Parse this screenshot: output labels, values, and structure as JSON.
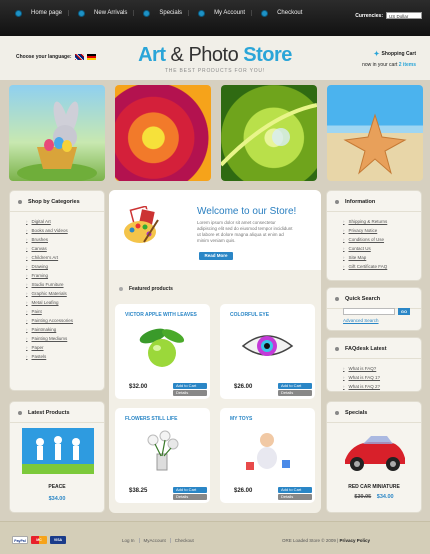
{
  "nav": {
    "items": [
      "Home page",
      "New Arrivals",
      "Specials",
      "My Account",
      "Checkout"
    ],
    "currency_label": "Currencies:",
    "currency_value": "US Dollar"
  },
  "header": {
    "language_label": "Choose your language:",
    "logo_part1": "Art",
    "logo_part2": "& Photo",
    "logo_part3": "Store",
    "tagline": "THE BEST PRODUCTS FOR YOU!",
    "cart_title": "Shopping Cart",
    "cart_line_prefix": "now in your cart",
    "cart_items": "2 items"
  },
  "categories": {
    "title": "Shop by Categories",
    "items": [
      "Digital Art",
      "Books and Videos",
      "Brushes",
      "Canvas",
      "Children's Art",
      "Drawing",
      "Framing",
      "Studio Furniture",
      "Graphic Materials",
      "Metal Leafing",
      "Paint",
      "Painting Accessories",
      "Paintmaking",
      "Painting Mediums",
      "Paper",
      "Pastels"
    ]
  },
  "latest": {
    "title": "Latest Products",
    "name": "PEACE",
    "price": "$34.00"
  },
  "welcome": {
    "title": "Welcome to our Store!",
    "text": "Lorem ipsum dolor sit amet consectetur adipiscing elit sed do eiusmod tempor incididunt ut labore et dolore magna aliqua ut enim ad minim veniam quis.",
    "more_label": "Read More"
  },
  "featured": {
    "title": "Featured products",
    "add_label": "Add to Cart",
    "details_label": "Details",
    "products": [
      {
        "name": "VICTOR APPLE WITH LEAVES",
        "price": "$32.00"
      },
      {
        "name": "COLORFUL EYE",
        "price": "$26.00"
      },
      {
        "name": "FLOWERS STILL LIFE",
        "price": "$38.25"
      },
      {
        "name": "MY TOYS",
        "price": "$26.00"
      }
    ]
  },
  "information": {
    "title": "Information",
    "items": [
      "Shipping & Returns",
      "Privacy Notice",
      "Conditions of Use",
      "Contact Us",
      "Site Map",
      "Gift Certificate FAQ"
    ]
  },
  "search": {
    "title": "Quick Search",
    "go_label": "GO",
    "advanced_label": "Advanced Search"
  },
  "faq": {
    "title": "FAQdesk Latest",
    "items": [
      "What is FAQ?",
      "What is FAQ 1?",
      "What is FAQ 2?"
    ]
  },
  "specials": {
    "title": "Specials",
    "name": "RED CAR MINIATURE",
    "old_price": "$39.95",
    "price": "$34.00"
  },
  "footer": {
    "pay_paypal": "PayPal",
    "pay_mc": "MC",
    "pay_visa": "VISA",
    "links": [
      "Log In",
      "MyAccount",
      "Checkout"
    ],
    "copyright": "ORE Loaded Store © 2009",
    "privacy": "Privacy Policy"
  },
  "colors": {
    "accent": "#2aa5d8",
    "button": "#2a86c6",
    "topbar": "#1a1a1a"
  }
}
